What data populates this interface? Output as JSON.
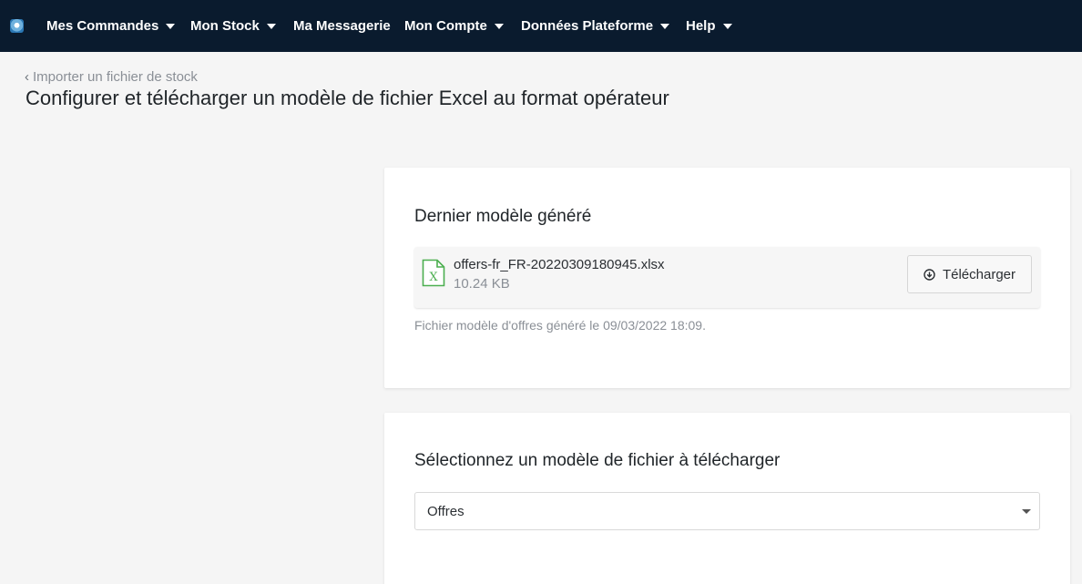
{
  "navbar": {
    "items": [
      {
        "label": "Mes Commandes",
        "has_dropdown": true
      },
      {
        "label": "Mon Stock",
        "has_dropdown": true
      },
      {
        "label": "Ma Messagerie",
        "has_dropdown": false
      },
      {
        "label": "Mon Compte",
        "has_dropdown": true
      },
      {
        "label": "Données Plateforme",
        "has_dropdown": true
      },
      {
        "label": "Help",
        "has_dropdown": true
      }
    ],
    "background": "#0a1b2e"
  },
  "header": {
    "back_link": "Importer un fichier de stock",
    "title": "Configurer et télécharger un modèle de fichier Excel au format opérateur"
  },
  "last_model": {
    "title": "Dernier modèle généré",
    "file_name": "offers-fr_FR-20220309180945.xlsx",
    "file_size": "10.24 KB",
    "download_label": "Télécharger",
    "note": "Fichier modèle d'offres généré le 09/03/2022 18:09.",
    "icon": "excel-file-icon",
    "icon_color": "#4caf50"
  },
  "select_model": {
    "title": "Sélectionnez un modèle de fichier à télécharger",
    "selected": "Offres"
  }
}
